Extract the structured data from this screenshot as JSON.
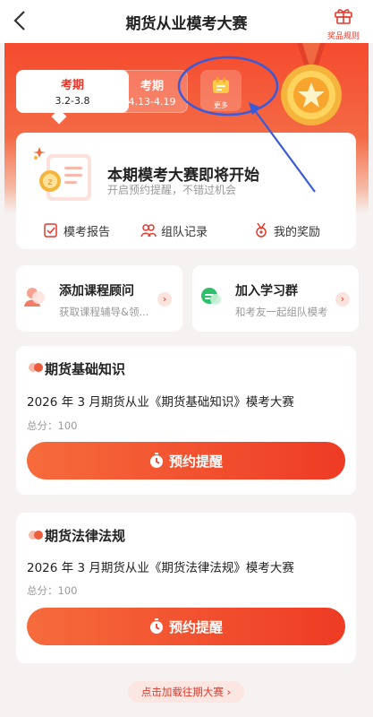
{
  "header": {
    "title": "期货从业模考大赛",
    "rules_label": "奖品规则"
  },
  "periods": [
    {
      "name": "考期",
      "range": "3.2-3.8",
      "active": true
    },
    {
      "name": "考期",
      "range": "4.13-4.19",
      "active": false
    }
  ],
  "more_label": "更多",
  "main_card": {
    "title": "本期模考大赛即将开始",
    "subtitle": "开启预约提醒，不错过机会",
    "actions": [
      {
        "label": "模考报告",
        "icon": "report-icon"
      },
      {
        "label": "组队记录",
        "icon": "team-icon"
      },
      {
        "label": "我的奖励",
        "icon": "medal-icon"
      }
    ]
  },
  "promo_cards": [
    {
      "title": "添加课程顾问",
      "subtitle": "获取课程辅导&领...",
      "icon": "advisor-icon"
    },
    {
      "title": "加入学习群",
      "subtitle": "和考友一起组队模考",
      "icon": "chat-icon"
    }
  ],
  "exams": [
    {
      "title": "期货基础知识",
      "name": "2026 年 3 月期货从业《期货基础知识》模考大赛",
      "score": "总分：100",
      "button": "预约提醒"
    },
    {
      "title": "期货法律法规",
      "name": "2026 年 3 月期货从业《期货法律法规》模考大赛",
      "score": "总分：100",
      "button": "预约提醒"
    }
  ],
  "load_more": "点击加载往期大赛",
  "colors": {
    "accent": "#e4382a",
    "hero_top": "#f54a2d",
    "button_start": "#f66b3c",
    "button_end": "#ee3b24",
    "annotation": "#3a5bd9"
  }
}
